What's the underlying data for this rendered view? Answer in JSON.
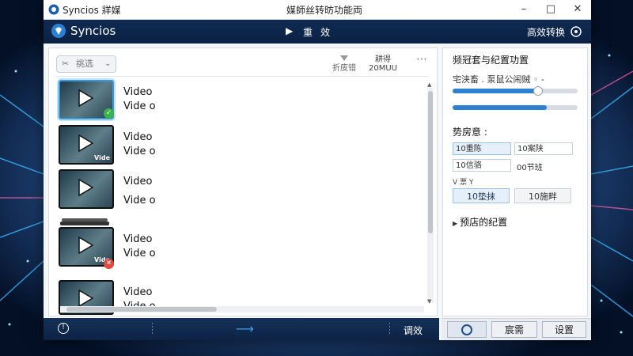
{
  "window": {
    "app_name": "Syncios 牂媒",
    "title": "媒師丝转昉功能両",
    "controls": {
      "minimize": "–",
      "maximize": "□",
      "close": "✕"
    }
  },
  "header": {
    "brand": "Syncios",
    "tab_play": "▶",
    "tab_label": "重效",
    "efficient_label": "高效转换"
  },
  "toolbar": {
    "filter": {
      "icon": "✂",
      "label": "挑选",
      "chevron": "⌄"
    },
    "tool_a_label": "折庋错",
    "tool_b_line1": "耕得",
    "tool_b_line2": "20MUU",
    "more": "⋯"
  },
  "files": [
    {
      "line1": "Video",
      "line2": "Vide o",
      "badge": "ok",
      "thumb_label": ""
    },
    {
      "line1": "Video",
      "line2": "Vide o",
      "badge": "",
      "thumb_label": "Vide"
    },
    {
      "line1": "Video",
      "line2": "Vide o",
      "badge": "",
      "thumb_label": ""
    },
    {
      "line1": "Video",
      "line2": "Vide o",
      "badge": "err",
      "thumb_label": "Vide"
    },
    {
      "line1": "Video",
      "line2": "Vide o",
      "badge": "",
      "thumb_label": ""
    }
  ],
  "panel": {
    "title": "频冠套与纪置功置",
    "subtitle": "宅浃畜 . 泵鼠公闹贼 ◦ -",
    "slider1_value": 0.68,
    "slider2_value": 0.75,
    "section_label": "势房意 :",
    "options": [
      "10重陈",
      "10案陕",
      "10信骆",
      "00节班"
    ],
    "small_label": "V 票 Y",
    "btn_a": "10垫抹",
    "btn_b": "10施畔",
    "preset_label": "预店的纪置"
  },
  "footer": {
    "info": "!",
    "arrow": "⟶",
    "effect_label": "调效"
  },
  "footer_right": {
    "search_label": "宸需",
    "settings_label": "设置"
  },
  "colors": {
    "accent": "#2f80d0",
    "header_bg": "#0f2a52",
    "ok": "#3ab44a",
    "err": "#e2483d"
  }
}
